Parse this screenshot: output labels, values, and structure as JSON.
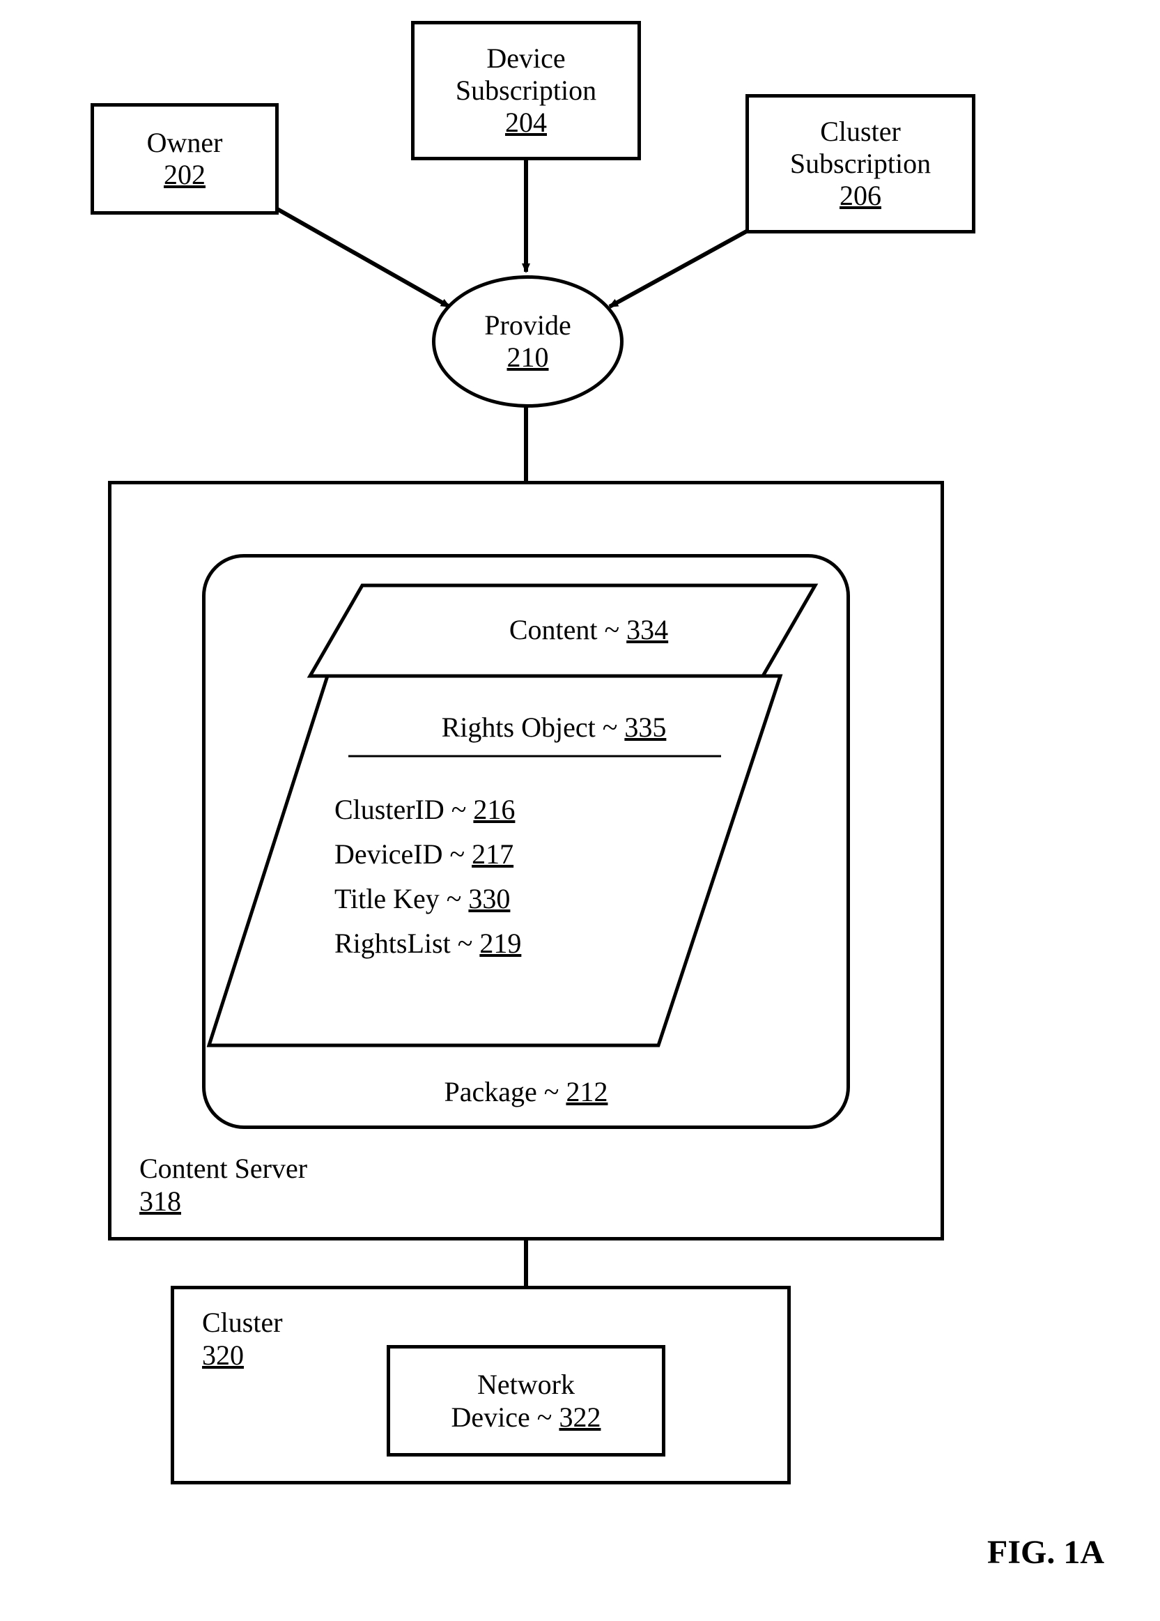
{
  "figure": "FIG. 1A",
  "owner": {
    "label": "Owner",
    "ref": "202"
  },
  "deviceSub": {
    "label1": "Device",
    "label2": "Subscription",
    "ref": "204"
  },
  "clusterSub": {
    "label1": "Cluster",
    "label2": "Subscription",
    "ref": "206"
  },
  "provide": {
    "label": "Provide",
    "ref": "210"
  },
  "contentServer": {
    "label": "Content Server",
    "ref": "318"
  },
  "package": {
    "label": "Package ~ ",
    "ref": "212"
  },
  "content": {
    "label": "Content  ~ ",
    "ref": "334"
  },
  "rightsObject": {
    "label": "Rights Object ~ ",
    "ref": "335"
  },
  "clusterID": {
    "label": "ClusterID ~ ",
    "ref": "216"
  },
  "deviceID": {
    "label": "DeviceID ~ ",
    "ref": "217"
  },
  "titleKey": {
    "label": "Title Key ~ ",
    "ref": "330"
  },
  "rightsList": {
    "label": "RightsList ~ ",
    "ref": "219"
  },
  "cluster": {
    "label": "Cluster",
    "ref": "320"
  },
  "networkDevice": {
    "label1": "Network",
    "label2": "Device ~ ",
    "ref": "322"
  }
}
